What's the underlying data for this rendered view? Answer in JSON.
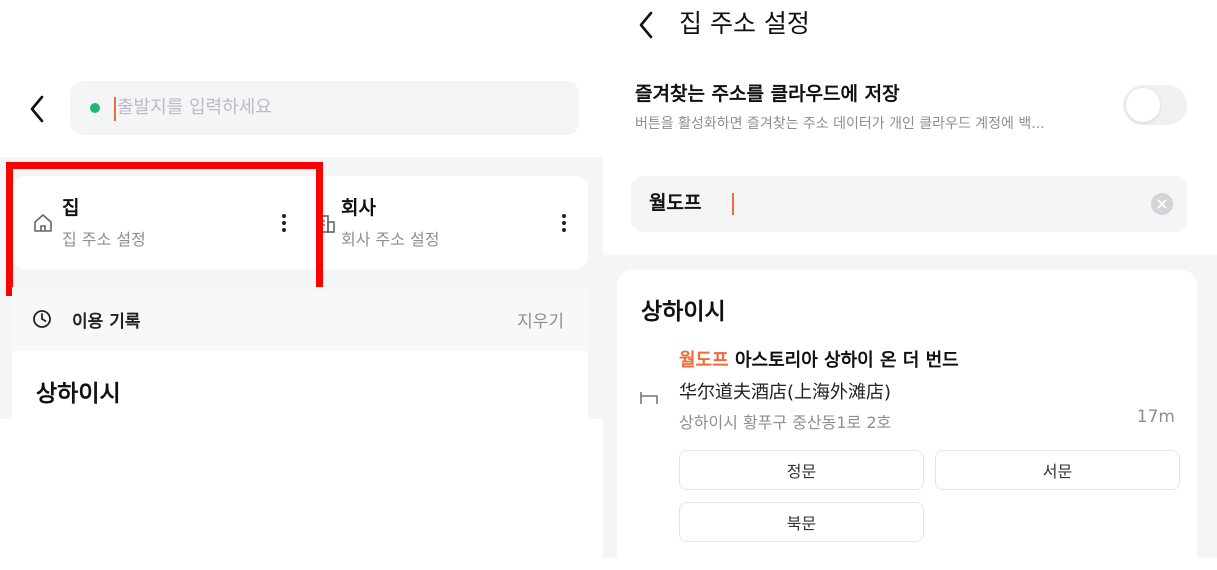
{
  "left": {
    "search": {
      "placeholder": "출발지를 입력하세요"
    },
    "favorites": [
      {
        "title": "집",
        "subtitle": "집 주소 설정"
      },
      {
        "title": "회사",
        "subtitle": "회사 주소 설정"
      }
    ],
    "history": {
      "title": "이용 기록",
      "clear_label": "지우기",
      "city": "상하이시"
    }
  },
  "right": {
    "title": "집 주소 설정",
    "cloud": {
      "title": "즐겨찾는 주소를 클라우드에 저장",
      "description": "버튼을 활성화하면 즐겨찾는 주소 데이터가 개인 클라우드 계정에 백...",
      "enabled": false
    },
    "search": {
      "value": "월도프"
    },
    "results": {
      "city": "상하이시",
      "place": {
        "highlight": "월도프",
        "name_rest": " 아스토리아 상하이 온 더 번드",
        "name_cn": "华尔道夫酒店(上海外滩店)",
        "address": "상하이시 황푸구 중산동1로 2호",
        "distance": "17m"
      },
      "gates": [
        "정문",
        "서문",
        "북문"
      ]
    }
  },
  "colors": {
    "accent": "#f06b3a",
    "green_dot": "#22b573",
    "highlight_box": "#ff0000"
  }
}
